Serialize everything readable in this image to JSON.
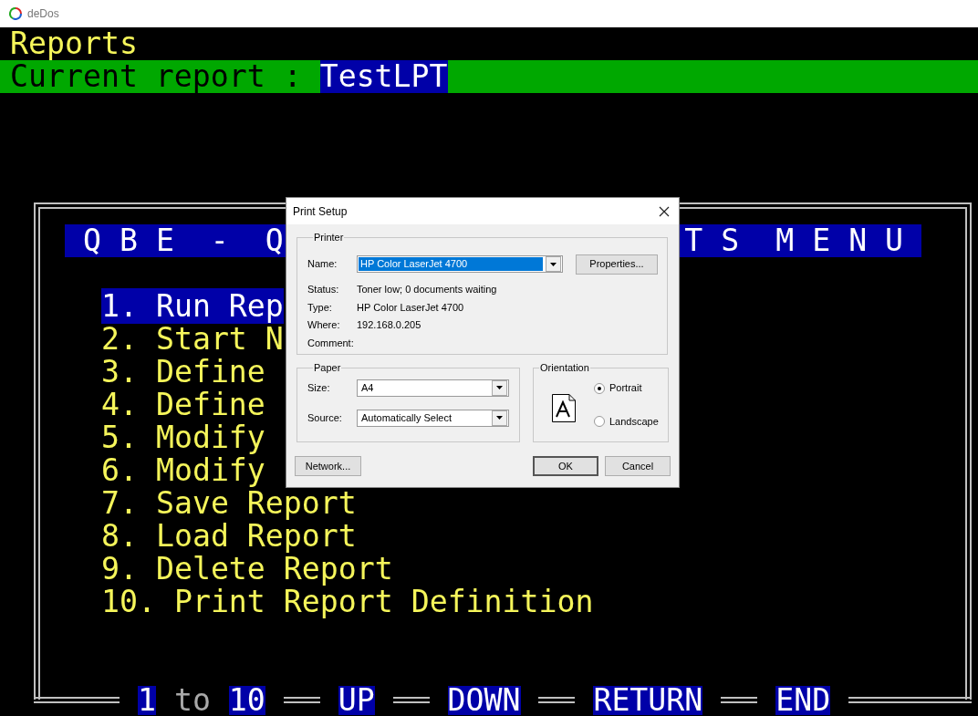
{
  "window": {
    "title": "deDos"
  },
  "terminal": {
    "heading": "Reports",
    "current_report_label": "Current report :",
    "current_report": "TestLPT",
    "menu_title": {
      "left": "Q B E  -  Q",
      "right": "T S  M E N U"
    },
    "menu_items": [
      {
        "label": "1. Run Rep",
        "selected": true
      },
      {
        "label": "2. Start N",
        "selected": false
      },
      {
        "label": "3. Define",
        "selected": false
      },
      {
        "label": "4. Define",
        "selected": false
      },
      {
        "label": "5. Modify",
        "selected": false
      },
      {
        "label": "6. Modify",
        "selected": false
      },
      {
        "label": "7. Save Report",
        "selected": false
      },
      {
        "label": "8. Load Report",
        "selected": false
      },
      {
        "label": "9. Delete Report",
        "selected": false
      },
      {
        "label": "10. Print Report Definition",
        "selected": false
      }
    ],
    "footer": [
      {
        "text": "1",
        "kind": "key"
      },
      {
        "text": "to",
        "kind": "word"
      },
      {
        "text": "10",
        "kind": "key"
      },
      {
        "text": "UP",
        "kind": "key"
      },
      {
        "text": "DOWN",
        "kind": "key"
      },
      {
        "text": "RETURN",
        "kind": "key"
      },
      {
        "text": "END",
        "kind": "key"
      }
    ]
  },
  "dialog": {
    "title": "Print Setup",
    "printer": {
      "legend": "Printer",
      "name_label": "Name:",
      "name": "HP Color LaserJet 4700",
      "properties_button": "Properties...",
      "info": [
        {
          "label": "Status:",
          "value": "Toner low; 0 documents waiting"
        },
        {
          "label": "Type:",
          "value": "HP Color LaserJet 4700"
        },
        {
          "label": "Where:",
          "value": "192.168.0.205"
        },
        {
          "label": "Comment:"
        }
      ]
    },
    "paper": {
      "legend": "Paper",
      "fields": [
        {
          "label": "Size:",
          "value": "A4"
        },
        {
          "label": "Source:",
          "value": "Automatically Select"
        }
      ]
    },
    "orientation": {
      "legend": "Orientation",
      "options": [
        {
          "label": "Portrait",
          "selected": true
        },
        {
          "label": "Landscape",
          "selected": false
        }
      ]
    },
    "buttons": [
      {
        "label": "Network...",
        "kind": "left"
      },
      {
        "label": "OK",
        "kind": "default"
      },
      {
        "label": "Cancel",
        "kind": "normal"
      }
    ]
  }
}
